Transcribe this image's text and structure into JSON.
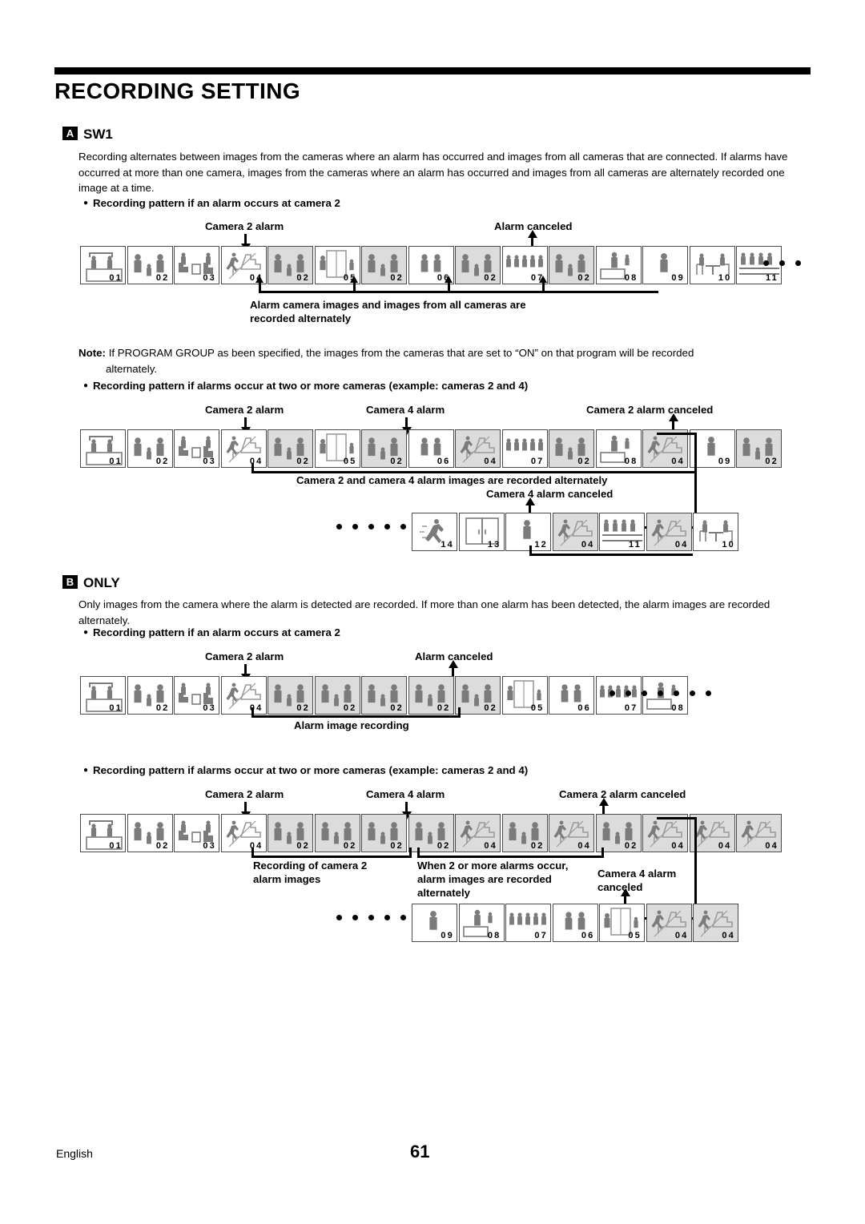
{
  "document": {
    "title": "RECORDING SETTING",
    "footer_language": "English",
    "footer_page": "61"
  },
  "sections": [
    {
      "badge": "A",
      "heading": "SW1",
      "body": "Recording alternates between images from the cameras where an alarm has occurred and images from all cameras that are connected. If alarms have occurred at more than one camera, images from the cameras where an alarm has occurred and images from all cameras are alternately recorded one image at a time.",
      "bullet1": "Recording pattern if an alarm occurs at camera 2",
      "note_label": "Note:",
      "note_text": "If PROGRAM GROUP as been specified, the images from the cameras that are set to “ON” on that program will be recorded",
      "note_text2": "alternately.",
      "note_bold": "ON",
      "bullet2": "Recording pattern if alarms occur at two or more cameras (example: cameras 2 and 4)"
    },
    {
      "badge": "B",
      "heading": "ONLY",
      "body": "Only images from the camera where the alarm is detected are recorded. If more than one alarm has been detected, the alarm images are recorded alternately.",
      "bullet1": "Recording pattern if an alarm occurs at camera 2",
      "bullet2": "Recording pattern if alarms occur at two or more cameras (example: cameras 2 and 4)"
    }
  ],
  "diagrams": {
    "a1": {
      "labels": {
        "camera2_alarm": "Camera 2 alarm",
        "alarm_canceled": "Alarm canceled",
        "caption_line1": "Alarm camera images and images from all cameras are",
        "caption_line2": "recorded alternately"
      },
      "frames": [
        {
          "num": "01",
          "icon": "reception",
          "highlight": false
        },
        {
          "num": "02",
          "icon": "three-people",
          "highlight": false
        },
        {
          "num": "03",
          "icon": "lounge",
          "highlight": false
        },
        {
          "num": "04",
          "icon": "stairs",
          "highlight": false
        },
        {
          "num": "02",
          "icon": "three-people",
          "highlight": true
        },
        {
          "num": "05",
          "icon": "elevator",
          "highlight": false
        },
        {
          "num": "02",
          "icon": "three-people",
          "highlight": true
        },
        {
          "num": "06",
          "icon": "two-people",
          "highlight": false
        },
        {
          "num": "02",
          "icon": "three-people",
          "highlight": true
        },
        {
          "num": "07",
          "icon": "crowd",
          "highlight": false
        },
        {
          "num": "02",
          "icon": "three-people",
          "highlight": true
        },
        {
          "num": "08",
          "icon": "counter",
          "highlight": false
        },
        {
          "num": "09",
          "icon": "one-person",
          "highlight": false
        },
        {
          "num": "10",
          "icon": "table",
          "highlight": false
        },
        {
          "num": "11",
          "icon": "seats",
          "highlight": false
        }
      ],
      "trailing_dots": 3
    },
    "a2": {
      "labels": {
        "camera2_alarm": "Camera 2 alarm",
        "camera4_alarm": "Camera 4 alarm",
        "camera2_canceled": "Camera 2 alarm canceled",
        "caption": "Camera 2 and camera 4 alarm images are recorded alternately",
        "camera4_canceled": "Camera 4 alarm canceled"
      },
      "frames_row1": [
        {
          "num": "01",
          "icon": "reception",
          "highlight": false
        },
        {
          "num": "02",
          "icon": "three-people",
          "highlight": false
        },
        {
          "num": "03",
          "icon": "lounge",
          "highlight": false
        },
        {
          "num": "04",
          "icon": "stairs",
          "highlight": false
        },
        {
          "num": "02",
          "icon": "three-people",
          "highlight": true
        },
        {
          "num": "05",
          "icon": "elevator",
          "highlight": false
        },
        {
          "num": "02",
          "icon": "three-people",
          "highlight": true
        },
        {
          "num": "06",
          "icon": "two-people",
          "highlight": false
        },
        {
          "num": "04",
          "icon": "stairs",
          "highlight": true
        },
        {
          "num": "07",
          "icon": "crowd",
          "highlight": false
        },
        {
          "num": "02",
          "icon": "three-people",
          "highlight": true
        },
        {
          "num": "08",
          "icon": "counter",
          "highlight": false
        },
        {
          "num": "04",
          "icon": "stairs",
          "highlight": true
        },
        {
          "num": "09",
          "icon": "one-person",
          "highlight": false
        },
        {
          "num": "02",
          "icon": "three-people",
          "highlight": true
        }
      ],
      "frames_row2": [
        {
          "num": "14",
          "icon": "running",
          "highlight": false
        },
        {
          "num": "13",
          "icon": "double-door",
          "highlight": false
        },
        {
          "num": "12",
          "icon": "one-person",
          "highlight": false
        },
        {
          "num": "04",
          "icon": "stairs",
          "highlight": true
        },
        {
          "num": "11",
          "icon": "seats",
          "highlight": false
        },
        {
          "num": "04",
          "icon": "stairs",
          "highlight": true
        },
        {
          "num": "10",
          "icon": "table",
          "highlight": false
        }
      ],
      "leading_dots": 5
    },
    "b1": {
      "labels": {
        "camera2_alarm": "Camera 2 alarm",
        "alarm_canceled": "Alarm canceled",
        "caption": "Alarm image recording"
      },
      "frames": [
        {
          "num": "01",
          "icon": "reception",
          "highlight": false
        },
        {
          "num": "02",
          "icon": "three-people",
          "highlight": false
        },
        {
          "num": "03",
          "icon": "lounge",
          "highlight": false
        },
        {
          "num": "04",
          "icon": "stairs",
          "highlight": false
        },
        {
          "num": "02",
          "icon": "three-people",
          "highlight": true
        },
        {
          "num": "02",
          "icon": "three-people",
          "highlight": true
        },
        {
          "num": "02",
          "icon": "three-people",
          "highlight": true
        },
        {
          "num": "02",
          "icon": "three-people",
          "highlight": true
        },
        {
          "num": "02",
          "icon": "three-people",
          "highlight": true
        },
        {
          "num": "05",
          "icon": "elevator",
          "highlight": false
        },
        {
          "num": "06",
          "icon": "two-people",
          "highlight": false
        },
        {
          "num": "07",
          "icon": "crowd",
          "highlight": false
        },
        {
          "num": "08",
          "icon": "counter",
          "highlight": false
        }
      ],
      "trailing_dots": 7
    },
    "b2": {
      "labels": {
        "camera2_alarm": "Camera 2 alarm",
        "camera4_alarm": "Camera 4 alarm",
        "camera2_canceled": "Camera 2 alarm canceled",
        "caption1_line1": "Recording of camera 2",
        "caption1_line2": "alarm images",
        "caption2_line1": "When 2 or more alarms occur,",
        "caption2_line2": "alarm images are recorded",
        "caption2_line3": "alternately",
        "caption3_line1": "Camera 4 alarm",
        "caption3_line2": "canceled"
      },
      "frames_row1": [
        {
          "num": "01",
          "icon": "reception",
          "highlight": false
        },
        {
          "num": "02",
          "icon": "three-people",
          "highlight": false
        },
        {
          "num": "03",
          "icon": "lounge",
          "highlight": false
        },
        {
          "num": "04",
          "icon": "stairs",
          "highlight": false
        },
        {
          "num": "02",
          "icon": "three-people",
          "highlight": true
        },
        {
          "num": "02",
          "icon": "three-people",
          "highlight": true
        },
        {
          "num": "02",
          "icon": "three-people",
          "highlight": true
        },
        {
          "num": "02",
          "icon": "three-people",
          "highlight": true
        },
        {
          "num": "04",
          "icon": "stairs",
          "highlight": true
        },
        {
          "num": "02",
          "icon": "three-people",
          "highlight": true
        },
        {
          "num": "04",
          "icon": "stairs",
          "highlight": true
        },
        {
          "num": "02",
          "icon": "three-people",
          "highlight": true
        },
        {
          "num": "04",
          "icon": "stairs",
          "highlight": true
        },
        {
          "num": "04",
          "icon": "stairs",
          "highlight": true
        },
        {
          "num": "04",
          "icon": "stairs",
          "highlight": true
        }
      ],
      "frames_row2": [
        {
          "num": "09",
          "icon": "one-person",
          "highlight": false
        },
        {
          "num": "08",
          "icon": "counter",
          "highlight": false
        },
        {
          "num": "07",
          "icon": "crowd",
          "highlight": false
        },
        {
          "num": "06",
          "icon": "two-people",
          "highlight": false
        },
        {
          "num": "05",
          "icon": "elevator",
          "highlight": false
        },
        {
          "num": "04",
          "icon": "stairs",
          "highlight": true
        },
        {
          "num": "04",
          "icon": "stairs",
          "highlight": true
        }
      ],
      "leading_dots": 6
    }
  },
  "colors": {
    "text": "#000000",
    "figure_gray": "#7b7b7b",
    "frame_border": "#4a4a4a",
    "highlight_bg": "#dcdcdc"
  }
}
